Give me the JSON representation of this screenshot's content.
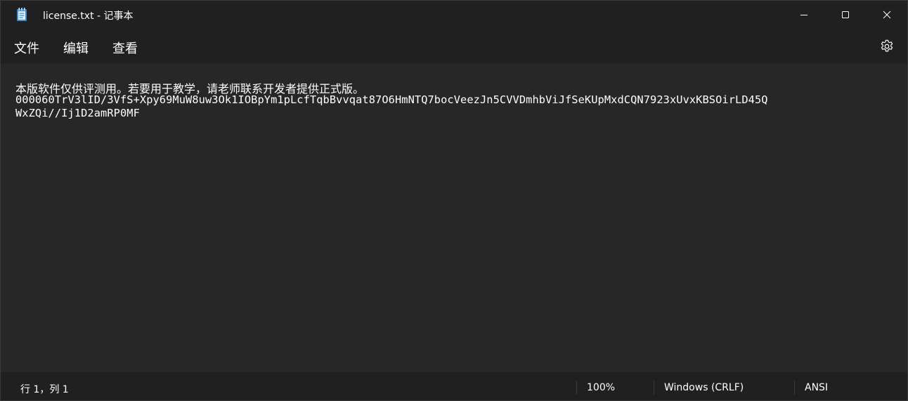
{
  "window": {
    "title": "license.txt - 记事本",
    "app_icon": "notepad-icon",
    "controls": {
      "minimize_icon": "minimize-icon",
      "maximize_icon": "maximize-icon",
      "close_icon": "close-icon"
    }
  },
  "menu": {
    "file": "文件",
    "edit": "编辑",
    "view": "查看",
    "settings_icon": "gear-icon"
  },
  "editor": {
    "lines": [
      "本版软件仅供评测用。若要用于教学，请老师联系开发者提供正式版。",
      "000060TrV3lID/3VfS+Xpy69MuW8uw3Ok1IOBpYm1pLcfTqbBvvqat87O6HmNTQ7bocVeezJn5CVVDmhbViJfSeKUpMxdCQN7923xUvxKBSOirLD45Q",
      "WxZQi//Ij1D2amRP0MF"
    ]
  },
  "status": {
    "position": "行 1，列 1",
    "zoom": "100%",
    "line_ending": "Windows (CRLF)",
    "encoding": "ANSI"
  },
  "colors": {
    "chrome_bg": "#202020",
    "editor_bg": "#272727",
    "text": "#ffffff",
    "icon_accent": "#3a8fd6"
  }
}
